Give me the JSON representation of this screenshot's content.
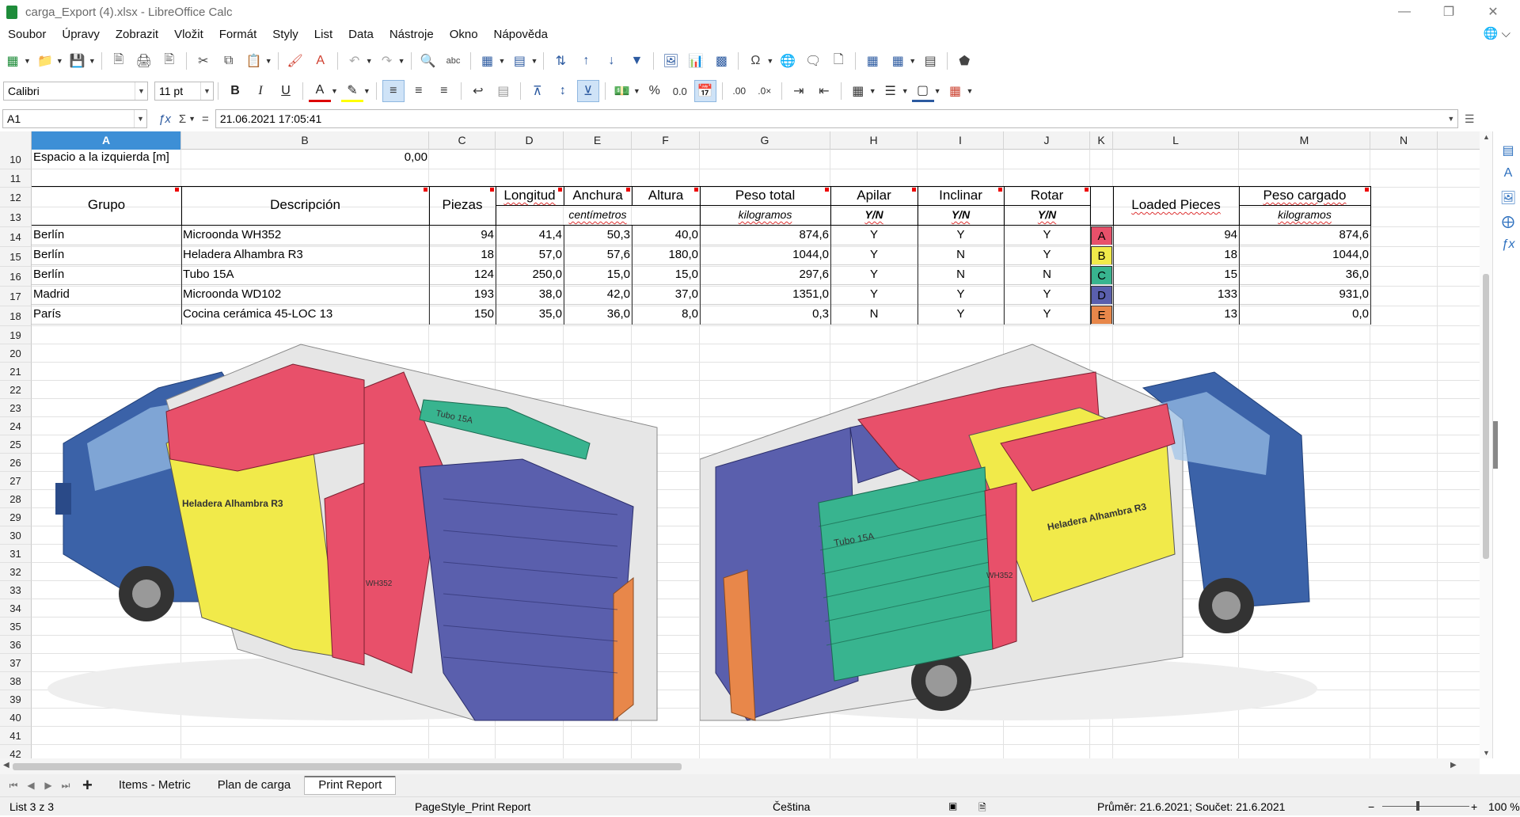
{
  "window": {
    "title": "carga_Export (4).xlsx - LibreOffice Calc"
  },
  "menu": [
    "Soubor",
    "Úpravy",
    "Zobrazit",
    "Vložit",
    "Formát",
    "Styly",
    "List",
    "Data",
    "Nástroje",
    "Okno",
    "Nápověda"
  ],
  "font": {
    "name": "Calibri",
    "size": "11 pt"
  },
  "formula": {
    "cell_ref": "A1",
    "value": "21.06.2021 17:05:41"
  },
  "columns": [
    "A",
    "B",
    "C",
    "D",
    "E",
    "F",
    "G",
    "H",
    "I",
    "J",
    "K",
    "L",
    "M",
    "N"
  ],
  "rows": [
    "10",
    "11",
    "12",
    "13",
    "14",
    "15",
    "16",
    "17",
    "18",
    "19",
    "20",
    "21",
    "22",
    "23",
    "24",
    "25",
    "26",
    "27",
    "28",
    "29",
    "30",
    "31",
    "32",
    "33",
    "34",
    "35",
    "36",
    "37",
    "38",
    "39",
    "40",
    "41",
    "42"
  ],
  "row10": {
    "label": "Espacio a la izquierda [m]",
    "value": "0,00"
  },
  "headers": {
    "grupo": "Grupo",
    "descripcion": "Descripción",
    "piezas": "Piezas",
    "longitud": "Longitud",
    "anchura": "Anchura",
    "altura": "Altura",
    "centimetros": "centímetros",
    "peso_total": "Peso total",
    "kilogramos": "kilogramos",
    "apilar": "Apilar",
    "inclinar": "Inclinar",
    "rotar": "Rotar",
    "yn": "Y/N",
    "loaded": "Loaded Pieces",
    "peso_cargado": "Peso cargado",
    "kilogramos2": "kilogramos"
  },
  "items": [
    {
      "row": "14",
      "grupo": "Berlín",
      "desc": "Microonda WH352",
      "piezas": "94",
      "longitud": "41,4",
      "anchura": "50,3",
      "altura": "40,0",
      "peso": "874,6",
      "apilar": "Y",
      "inclinar": "Y",
      "rotar": "Y",
      "label": "A",
      "color": "#e8506a",
      "loaded": "94",
      "peso_cargado": "874,6"
    },
    {
      "row": "15",
      "grupo": "Berlín",
      "desc": "Heladera Alhambra R3",
      "piezas": "18",
      "longitud": "57,0",
      "anchura": "57,6",
      "altura": "180,0",
      "peso": "1044,0",
      "apilar": "Y",
      "inclinar": "N",
      "rotar": "Y",
      "label": "B",
      "color": "#f1ea4a",
      "loaded": "18",
      "peso_cargado": "1044,0"
    },
    {
      "row": "16",
      "grupo": "Berlín",
      "desc": "Tubo 15A",
      "piezas": "124",
      "longitud": "250,0",
      "anchura": "15,0",
      "altura": "15,0",
      "peso": "297,6",
      "apilar": "Y",
      "inclinar": "N",
      "rotar": "N",
      "label": "C",
      "color": "#38b48f",
      "loaded": "15",
      "peso_cargado": "36,0"
    },
    {
      "row": "17",
      "grupo": "Madrid",
      "desc": "Microonda WD102",
      "piezas": "193",
      "longitud": "38,0",
      "anchura": "42,0",
      "altura": "37,0",
      "peso": "1351,0",
      "apilar": "Y",
      "inclinar": "Y",
      "rotar": "Y",
      "label": "D",
      "color": "#5a5fad",
      "loaded": "133",
      "peso_cargado": "931,0"
    },
    {
      "row": "18",
      "grupo": "París",
      "desc": "Cocina cerámica 45-LOC 13",
      "piezas": "150",
      "longitud": "35,0",
      "anchura": "36,0",
      "altura": "8,0",
      "peso": "0,3",
      "apilar": "N",
      "inclinar": "Y",
      "rotar": "Y",
      "label": "E",
      "color": "#e8874a",
      "loaded": "13",
      "peso_cargado": "0,0"
    }
  ],
  "truck_labels": {
    "fridge": "Heladera Alhambra R3",
    "tube": "Tubo 15A",
    "micro": "WH352"
  },
  "tabs": [
    "Items - Metric",
    "Plan de carga",
    "Print Report"
  ],
  "active_tab": "Print Report",
  "status": {
    "sheet": "List 3 z 3",
    "page_style": "PageStyle_Print Report",
    "language": "Čeština",
    "summary": "Průměr: 21.6.2021; Součet: 21.6.2021",
    "zoom": "100 %"
  }
}
